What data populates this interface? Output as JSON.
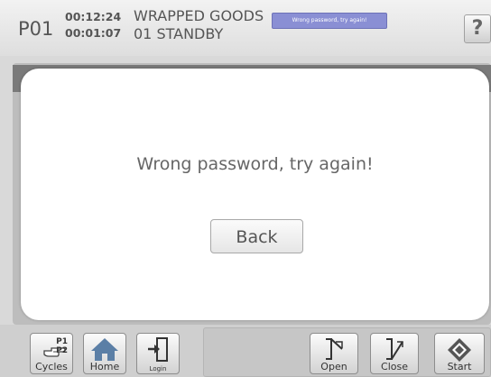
{
  "header": {
    "program": "P01",
    "time_total": "00:12:24",
    "time_step": "00:01:07",
    "status_line1": "WRAPPED GOODS",
    "status_line2": "01 STANDBY",
    "message_badge": "Wrong password, try again!",
    "help_label": "?"
  },
  "modal": {
    "message": "Wrong password, try again!",
    "back_label": "Back"
  },
  "toolbar": {
    "cycles_label": "Cycles",
    "cycles_p1": "P1",
    "cycles_p2": "P2",
    "home_label": "Home",
    "login_label": "Login",
    "open_label": "Open",
    "close_label": "Close",
    "start_label": "Start"
  }
}
